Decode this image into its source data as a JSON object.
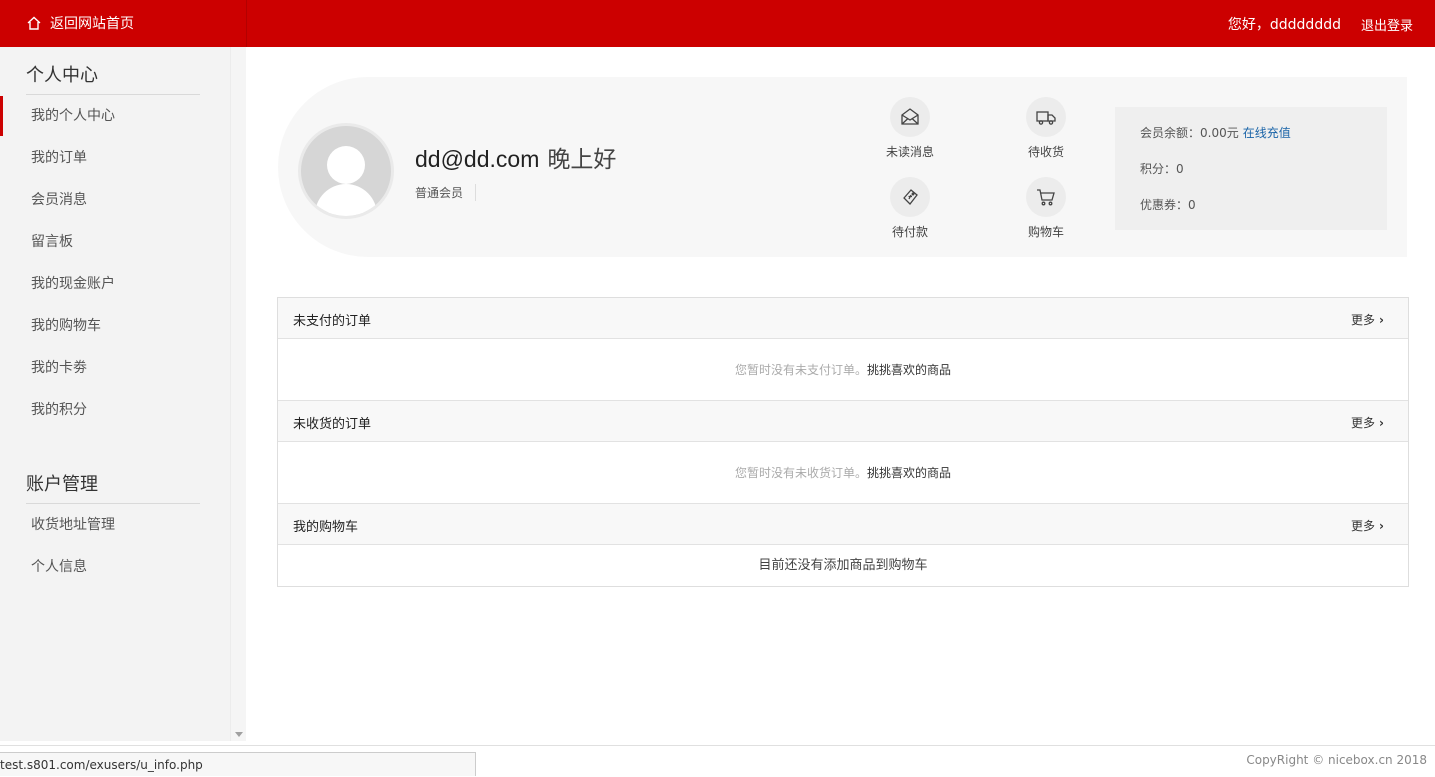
{
  "topbar": {
    "home_label": "返回网站首页",
    "greeting": "您好，dddddddd",
    "logout_label": "退出登录",
    "accent": "#cc0000"
  },
  "sidebar": {
    "section1_title": "个人中心",
    "section1_items": [
      {
        "label": "我的个人中心",
        "active": true
      },
      {
        "label": "我的订单"
      },
      {
        "label": "会员消息"
      },
      {
        "label": "留言板"
      },
      {
        "label": "我的现金账户"
      },
      {
        "label": "我的购物车"
      },
      {
        "label": "我的卡劵"
      },
      {
        "label": "我的积分"
      }
    ],
    "section2_title": "账户管理",
    "section2_items": [
      {
        "label": "收货地址管理"
      },
      {
        "label": "个人信息"
      }
    ]
  },
  "profile": {
    "email": "dd@dd.com",
    "salutation": "晚上好",
    "level": "普通会员",
    "quick": [
      {
        "label": "未读消息",
        "icon": "envelope-icon"
      },
      {
        "label": "待收货",
        "icon": "truck-icon"
      },
      {
        "label": "待付款",
        "icon": "ticket-icon"
      },
      {
        "label": "购物车",
        "icon": "cart-icon"
      }
    ],
    "wallet": {
      "balance_label": "会员余额：",
      "balance_value": "0.00元",
      "recharge_label": "在线充值",
      "points_label": "积分：",
      "points_value": "0",
      "coupon_label": "优惠券：",
      "coupon_value": "0"
    }
  },
  "panels": [
    {
      "title": "未支付的订单",
      "more": "更多",
      "empty": "您暂时没有未支付订单。",
      "pick": "挑挑喜欢的商品"
    },
    {
      "title": "未收货的订单",
      "more": "更多",
      "empty": "您暂时没有未收货订单。",
      "pick": "挑挑喜欢的商品"
    },
    {
      "title": "我的购物车",
      "more": "更多",
      "empty_cart": "目前还没有添加商品到购物车"
    }
  ],
  "footer": {
    "status_url": "test.s801.com/exusers/u_info.php",
    "copyright": "CopyRight © nicebox.cn 2018"
  }
}
